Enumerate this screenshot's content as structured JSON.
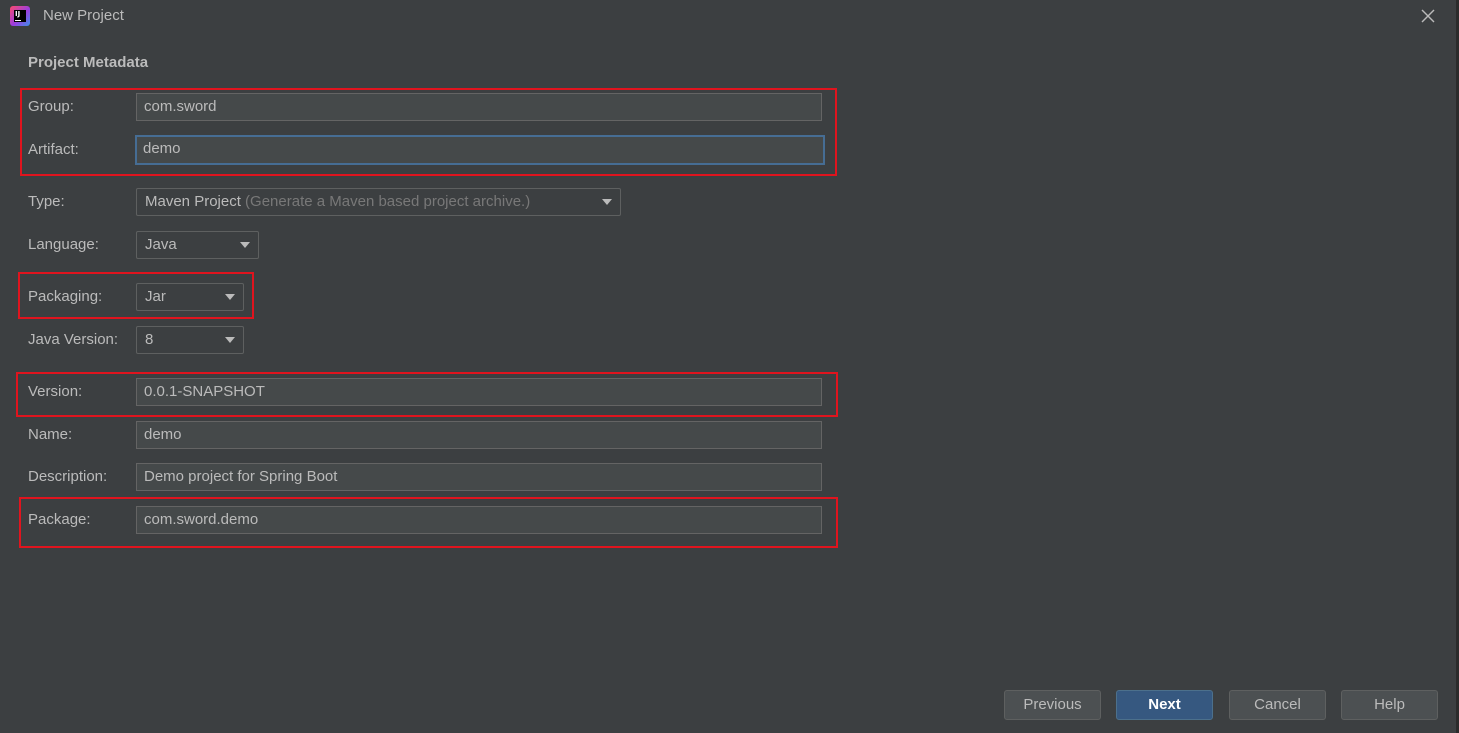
{
  "window": {
    "title": "New Project",
    "app_icon_text": "IJ"
  },
  "section": {
    "title": "Project Metadata"
  },
  "form": {
    "group": {
      "label": "Group:",
      "value": "com.sword"
    },
    "artifact": {
      "label": "Artifact:",
      "value": "demo"
    },
    "type": {
      "label": "Type:",
      "value": "Maven Project",
      "hint": "(Generate a Maven based project archive.)"
    },
    "language": {
      "label": "Language:",
      "value": "Java"
    },
    "packaging": {
      "label": "Packaging:",
      "value": "Jar"
    },
    "java_version": {
      "label": "Java Version:",
      "value": "8"
    },
    "version": {
      "label": "Version:",
      "value": "0.0.1-SNAPSHOT"
    },
    "name": {
      "label": "Name:",
      "value": "demo"
    },
    "description": {
      "label": "Description:",
      "value": "Demo project for Spring Boot"
    },
    "package": {
      "label": "Package:",
      "value": "com.sword.demo"
    }
  },
  "buttons": {
    "previous": "Previous",
    "next": "Next",
    "cancel": "Cancel",
    "help": "Help"
  },
  "colors": {
    "background": "#3c3f41",
    "field_background": "#45494a",
    "highlight_border": "#e0141e",
    "primary_button": "#365880",
    "focus_border": "#466d94"
  },
  "icons": {
    "app": "intellij-idea-icon",
    "close": "close-icon",
    "dropdown": "chevron-down-icon"
  }
}
